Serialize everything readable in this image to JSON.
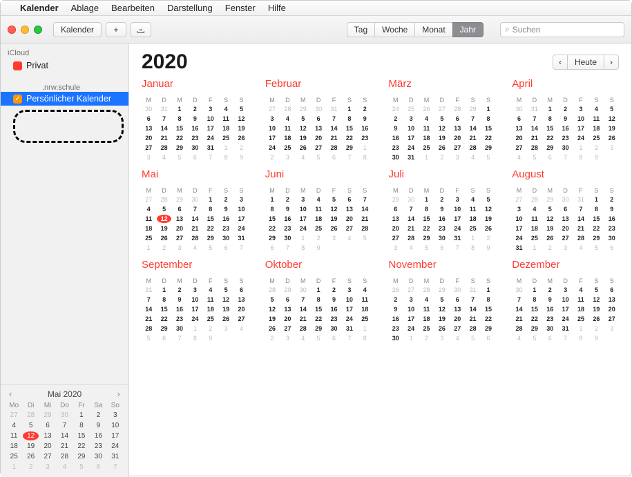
{
  "menubar": {
    "apple": "",
    "app": "Kalender",
    "items": [
      "Ablage",
      "Bearbeiten",
      "Darstellung",
      "Fenster",
      "Hilfe"
    ]
  },
  "toolbar": {
    "kalender": "Kalender",
    "plus": "+",
    "download": "⇩",
    "views": [
      "Tag",
      "Woche",
      "Monat",
      "Jahr"
    ],
    "view_selected": 3,
    "search_icon": "⌕",
    "search_placeholder": "Suchen"
  },
  "sidebar": {
    "section": "iCloud",
    "calendars": [
      {
        "label": "Privat",
        "color": "#ff3b30",
        "checked": false,
        "selected": false
      },
      {
        "label": "Persönlicher Kalender",
        "color": "#ff9500",
        "checked": true,
        "selected": true
      }
    ],
    "nrw_label": ".nrw.schule"
  },
  "mini": {
    "title": "Mai 2020",
    "dow": [
      "Mo",
      "Di",
      "Mi",
      "Do",
      "Fr",
      "Sa",
      "So"
    ],
    "prev": "‹",
    "next": "›",
    "weeks": [
      [
        {
          "n": 27,
          "out": true
        },
        {
          "n": 28,
          "out": true
        },
        {
          "n": 29,
          "out": true
        },
        {
          "n": 30,
          "out": true
        },
        {
          "n": 1
        },
        {
          "n": 2
        },
        {
          "n": 3
        }
      ],
      [
        {
          "n": 4
        },
        {
          "n": 5
        },
        {
          "n": 6
        },
        {
          "n": 7
        },
        {
          "n": 8
        },
        {
          "n": 9
        },
        {
          "n": 10
        }
      ],
      [
        {
          "n": 11
        },
        {
          "n": 12,
          "today": true
        },
        {
          "n": 13
        },
        {
          "n": 14
        },
        {
          "n": 15
        },
        {
          "n": 16
        },
        {
          "n": 17
        }
      ],
      [
        {
          "n": 18
        },
        {
          "n": 19
        },
        {
          "n": 20
        },
        {
          "n": 21
        },
        {
          "n": 22
        },
        {
          "n": 23
        },
        {
          "n": 24
        }
      ],
      [
        {
          "n": 25
        },
        {
          "n": 26
        },
        {
          "n": 27
        },
        {
          "n": 28
        },
        {
          "n": 29
        },
        {
          "n": 30
        },
        {
          "n": 31
        }
      ],
      [
        {
          "n": 1,
          "out": true
        },
        {
          "n": 2,
          "out": true
        },
        {
          "n": 3,
          "out": true
        },
        {
          "n": 4,
          "out": true
        },
        {
          "n": 5,
          "out": true
        },
        {
          "n": 6,
          "out": true
        },
        {
          "n": 7,
          "out": true
        }
      ]
    ]
  },
  "year": {
    "title": "2020",
    "today_label": "Heute",
    "prev": "‹",
    "next": "›",
    "dow": [
      "M",
      "D",
      "M",
      "D",
      "F",
      "S",
      "S"
    ],
    "today": {
      "month": 4,
      "day": 12
    },
    "months": [
      {
        "name": "Januar",
        "start": 2,
        "days": 31,
        "prev": 31,
        "next": true
      },
      {
        "name": "Februar",
        "start": 5,
        "days": 29,
        "prev": 31,
        "next": true
      },
      {
        "name": "März",
        "start": 6,
        "days": 31,
        "prev": 29,
        "next": true
      },
      {
        "name": "April",
        "start": 2,
        "days": 30,
        "prev": 31,
        "next": true
      },
      {
        "name": "Mai",
        "start": 4,
        "days": 31,
        "prev": 30,
        "next": true
      },
      {
        "name": "Juni",
        "start": 0,
        "days": 30,
        "prev": 31,
        "next": true
      },
      {
        "name": "Juli",
        "start": 2,
        "days": 31,
        "prev": 30,
        "next": true
      },
      {
        "name": "August",
        "start": 5,
        "days": 31,
        "prev": 31,
        "next": true
      },
      {
        "name": "September",
        "start": 1,
        "days": 30,
        "prev": 31,
        "next": true
      },
      {
        "name": "Oktober",
        "start": 3,
        "days": 31,
        "prev": 30,
        "next": true
      },
      {
        "name": "November",
        "start": 6,
        "days": 30,
        "prev": 31,
        "next": true
      },
      {
        "name": "Dezember",
        "start": 1,
        "days": 31,
        "prev": 30,
        "next": true
      }
    ]
  }
}
